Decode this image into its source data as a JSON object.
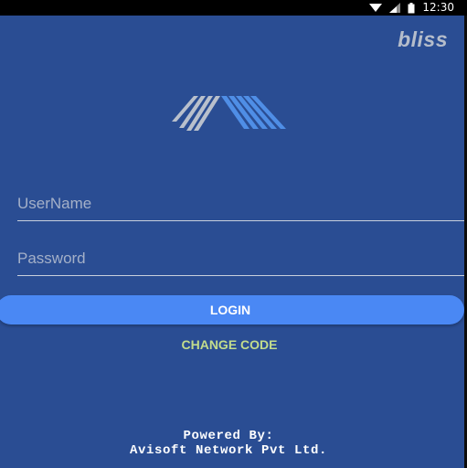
{
  "status_bar": {
    "time": "12:30",
    "icons": [
      "wifi-icon",
      "signal-icon",
      "battery-icon"
    ]
  },
  "brand": {
    "name": "bliss"
  },
  "login_form": {
    "username_placeholder": "UserName",
    "username_value": "",
    "password_placeholder": "Password",
    "password_value": "",
    "login_label": "LOGIN",
    "change_code_label": "CHANGE CODE"
  },
  "footer": {
    "line1": "Powered By:",
    "line2": "Avisoft Network Pvt Ltd."
  },
  "colors": {
    "background": "#2a4d93",
    "login_button": "#4a88f4",
    "change_code": "#c3dd8c",
    "brand_text": "#b5bdcb"
  }
}
